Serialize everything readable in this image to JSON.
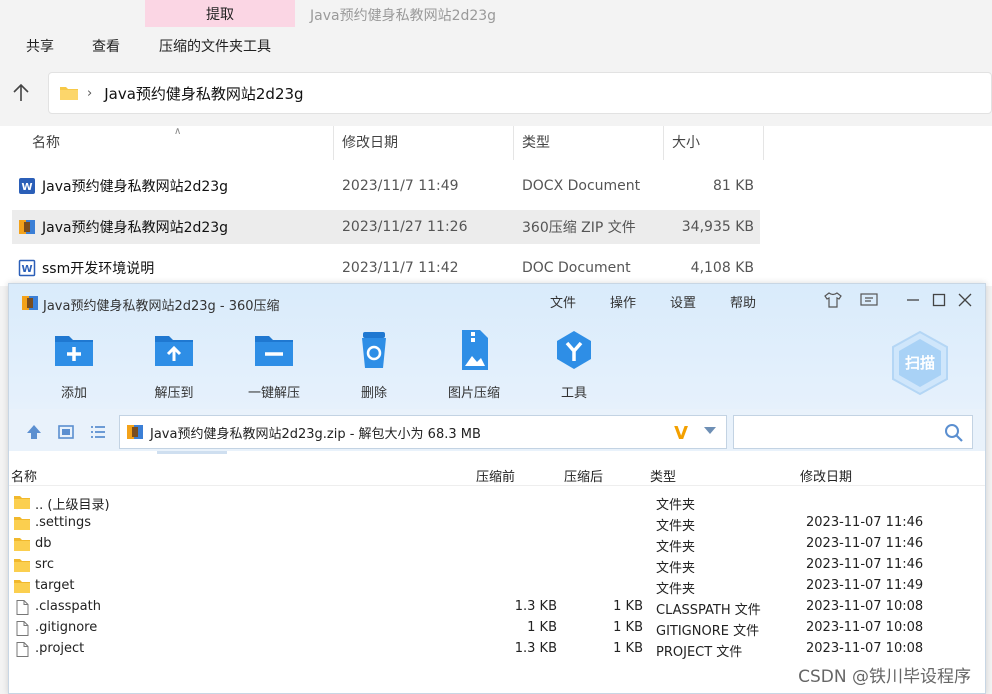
{
  "explorer": {
    "tab_extract": "提取",
    "window_title": "Java预约健身私教网站2d23g",
    "ribbon": [
      "共享",
      "查看",
      "压缩的文件夹工具"
    ],
    "address_path": "Java预约健身私教网站2d23g",
    "columns": {
      "name": "名称",
      "date": "修改日期",
      "type": "类型",
      "size": "大小"
    },
    "files": [
      {
        "name": "Java预约健身私教网站2d23g",
        "date": "2023/11/7 11:49",
        "type": "DOCX Document",
        "size": "81 KB",
        "icon": "word-docx-icon"
      },
      {
        "name": "Java预约健身私教网站2d23g",
        "date": "2023/11/27 11:26",
        "type": "360压缩 ZIP 文件",
        "size": "34,935 KB",
        "icon": "zip-archive-icon"
      },
      {
        "name": "ssm开发环境说明",
        "date": "2023/11/7 11:42",
        "type": "DOC Document",
        "size": "4,108 KB",
        "icon": "word-doc-icon"
      }
    ]
  },
  "zip": {
    "title": "Java预约健身私教网站2d23g - 360压缩",
    "menu": [
      "文件",
      "操作",
      "设置",
      "帮助"
    ],
    "toolbar": [
      {
        "label": "添加",
        "icon": "add-folder-icon"
      },
      {
        "label": "解压到",
        "icon": "extract-to-icon"
      },
      {
        "label": "一键解压",
        "icon": "one-click-extract-icon"
      },
      {
        "label": "删除",
        "icon": "delete-bin-icon"
      },
      {
        "label": "图片压缩",
        "icon": "image-compress-icon"
      },
      {
        "label": "工具",
        "icon": "tools-icon"
      }
    ],
    "scan_label": "扫描",
    "address": "Java预约健身私教网站2d23g.zip - 解包大小为 68.3 MB",
    "columns": {
      "name": "名称",
      "before": "压缩前",
      "after": "压缩后",
      "type": "类型",
      "date": "修改日期"
    },
    "entries": [
      {
        "name": ".. (上级目录)",
        "before": "",
        "after": "",
        "type": "文件夹",
        "date": "",
        "kind": "folder"
      },
      {
        "name": ".settings",
        "before": "",
        "after": "",
        "type": "文件夹",
        "date": "2023-11-07 11:46",
        "kind": "folder"
      },
      {
        "name": "db",
        "before": "",
        "after": "",
        "type": "文件夹",
        "date": "2023-11-07 11:46",
        "kind": "folder"
      },
      {
        "name": "src",
        "before": "",
        "after": "",
        "type": "文件夹",
        "date": "2023-11-07 11:46",
        "kind": "folder"
      },
      {
        "name": "target",
        "before": "",
        "after": "",
        "type": "文件夹",
        "date": "2023-11-07 11:49",
        "kind": "folder"
      },
      {
        "name": ".classpath",
        "before": "1.3 KB",
        "after": "1 KB",
        "type": "CLASSPATH 文件",
        "date": "2023-11-07 10:08",
        "kind": "file"
      },
      {
        "name": ".gitignore",
        "before": "1 KB",
        "after": "1 KB",
        "type": "GITIGNORE 文件",
        "date": "2023-11-07 10:08",
        "kind": "file"
      },
      {
        "name": ".project",
        "before": "1.3 KB",
        "after": "1 KB",
        "type": "PROJECT 文件",
        "date": "2023-11-07 10:08",
        "kind": "file"
      }
    ]
  },
  "watermark": "CSDN @铁川毕设程序"
}
